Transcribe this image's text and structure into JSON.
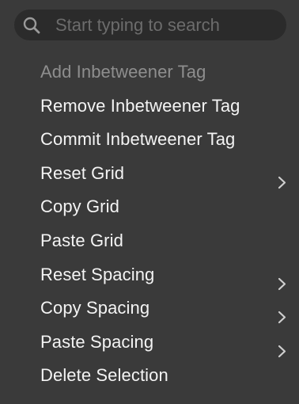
{
  "search": {
    "placeholder": "Start typing to search",
    "value": "",
    "icon": "search-icon"
  },
  "menu": {
    "items": [
      {
        "label": "Add Inbetweener Tag",
        "enabled": false,
        "has_submenu": false
      },
      {
        "label": "Remove Inbetweener Tag",
        "enabled": true,
        "has_submenu": false
      },
      {
        "label": "Commit Inbetweener Tag",
        "enabled": true,
        "has_submenu": false
      },
      {
        "label": "Reset Grid",
        "enabled": true,
        "has_submenu": true
      },
      {
        "label": "Copy Grid",
        "enabled": true,
        "has_submenu": false
      },
      {
        "label": "Paste Grid",
        "enabled": true,
        "has_submenu": false
      },
      {
        "label": "Reset Spacing",
        "enabled": true,
        "has_submenu": true
      },
      {
        "label": "Copy Spacing",
        "enabled": true,
        "has_submenu": true
      },
      {
        "label": "Paste Spacing",
        "enabled": true,
        "has_submenu": true
      },
      {
        "label": "Delete Selection",
        "enabled": true,
        "has_submenu": false
      }
    ]
  },
  "colors": {
    "background": "#3a3a3a",
    "search_background": "#2b2b2b",
    "text": "#f4f4f4",
    "disabled_text": "#8e8e8e",
    "placeholder": "#6c6c6c"
  }
}
